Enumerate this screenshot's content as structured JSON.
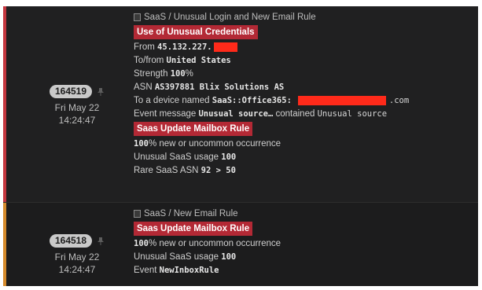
{
  "events": [
    {
      "id": "164519",
      "date": "Fri May 22",
      "time": "14:24:47",
      "category": "SaaS / Unusual Login and New Email Rule",
      "tag1": "Use of Unusual Credentials",
      "from_label": "From",
      "from_value": "45.132.227.",
      "tofrom_label": "To/from",
      "tofrom_value": "United States",
      "strength_label": "Strength",
      "strength_value": "100",
      "strength_unit": "%",
      "asn_label": "ASN",
      "asn_value": "AS397881 Blix Solutions AS",
      "device_label": "To a device named",
      "device_value": "SaaS::Office365:",
      "device_suffix": ".com",
      "event_msg_label": "Event message",
      "event_msg_value": "Unusual source…",
      "event_msg_mid": "contained",
      "event_msg_tail": "Unusual source",
      "tag2": "Saas Update Mailbox Rule",
      "occ_value": "100",
      "occ_text": "% new or uncommon occurrence",
      "usage_label": "Unusual SaaS usage",
      "usage_value": "100",
      "rare_label": "Rare SaaS ASN",
      "rare_value": "92 > 50"
    },
    {
      "id": "164518",
      "date": "Fri May 22",
      "time": "14:24:47",
      "category": "SaaS / New Email Rule",
      "tag1": "Saas Update Mailbox Rule",
      "occ_value": "100",
      "occ_text": "% new or uncommon occurrence",
      "usage_label": "Unusual SaaS usage",
      "usage_value": "100",
      "event_label": "Event",
      "event_value": "NewInboxRule"
    }
  ],
  "colors": {
    "severity_high": "#c4373f",
    "severity_medium": "#d48a2c",
    "tag_bg": "#b32935",
    "redaction": "#ff2a1a"
  },
  "icons": {
    "pin": "pin-icon",
    "category": "saas-category-icon"
  }
}
